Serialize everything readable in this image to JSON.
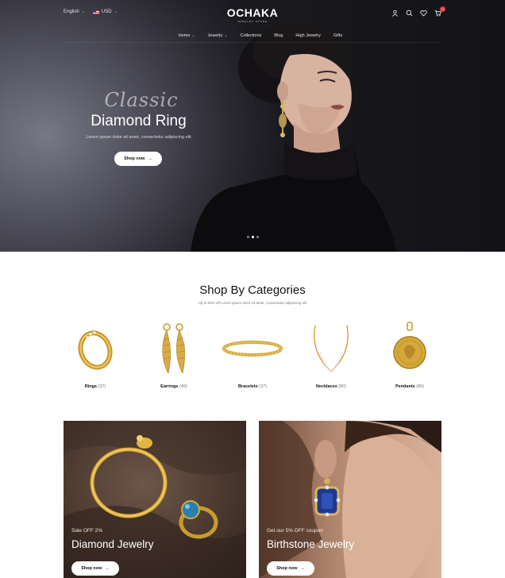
{
  "topbar": {
    "language": "English",
    "currency": "USD",
    "cart_count": "0"
  },
  "brand": {
    "name": "OCHAKA",
    "tagline": "JEWELRY STORE"
  },
  "nav": {
    "items": [
      {
        "label": "Home",
        "has_dropdown": true
      },
      {
        "label": "Jewelry",
        "has_dropdown": true
      },
      {
        "label": "Collections",
        "has_dropdown": false
      },
      {
        "label": "Blog",
        "has_dropdown": false
      },
      {
        "label": "High Jewelry",
        "has_dropdown": false
      },
      {
        "label": "Gifts",
        "has_dropdown": false
      }
    ]
  },
  "hero": {
    "script": "Classic",
    "title": "Diamond Ring",
    "subtitle": "Lorem ipsum dolor sit amet, consectetur adipiscing elit",
    "button": "Shop now",
    "slides_active": 2,
    "slides_total": 3
  },
  "categories": {
    "title": "Shop By Categories",
    "subtitle": "Up to 50% off Lorem ipsum dolor sit amet, consectetur adipiscing elit",
    "items": [
      {
        "name": "Rings",
        "count": "(37)"
      },
      {
        "name": "Earrings",
        "count": "(49)"
      },
      {
        "name": "Bracelets",
        "count": "(37)"
      },
      {
        "name": "Necklaces",
        "count": "(80)"
      },
      {
        "name": "Pendants",
        "count": "(89)"
      }
    ]
  },
  "promos": [
    {
      "kicker": "Sale OFF 2%",
      "title": "Diamond Jewelry",
      "button": "Shop now"
    },
    {
      "kicker": "Get our 5% OFF coupon",
      "title": "Birthstone Jewelry",
      "button": "Shop now"
    }
  ],
  "colors": {
    "badge": "#e03a4a",
    "gold": "#d4a93a"
  }
}
